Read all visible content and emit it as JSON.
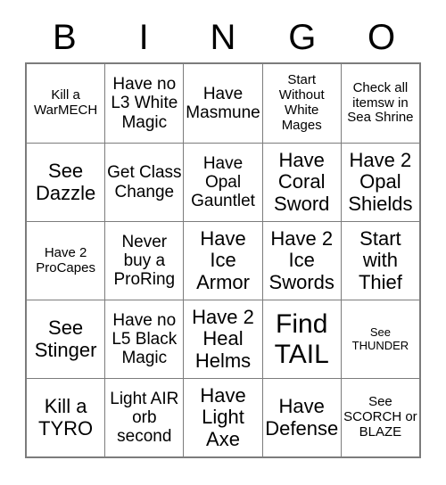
{
  "card": {
    "header": {
      "letters": [
        "B",
        "I",
        "N",
        "G",
        "O"
      ]
    },
    "rows": [
      [
        {
          "text": "Kill a WarMECH",
          "size": "fs-sm"
        },
        {
          "text": "Have no L3 White Magic",
          "size": "fs-md"
        },
        {
          "text": "Have Masmune",
          "size": "fs-md"
        },
        {
          "text": "Start Without White Mages",
          "size": "fs-sm"
        },
        {
          "text": "Check all itemsw in Sea Shrine",
          "size": "fs-sm"
        }
      ],
      [
        {
          "text": "See Dazzle",
          "size": "fs-lg"
        },
        {
          "text": "Get Class Change",
          "size": "fs-md"
        },
        {
          "text": "Have Opal Gauntlet",
          "size": "fs-md"
        },
        {
          "text": "Have Coral Sword",
          "size": "fs-lg"
        },
        {
          "text": "Have 2 Opal Shields",
          "size": "fs-lg"
        }
      ],
      [
        {
          "text": "Have 2 ProCapes",
          "size": "fs-sm"
        },
        {
          "text": "Never buy a ProRing",
          "size": "fs-md"
        },
        {
          "text": "Have Ice Armor",
          "size": "fs-lg"
        },
        {
          "text": "Have 2 Ice Swords",
          "size": "fs-lg"
        },
        {
          "text": "Start with Thief",
          "size": "fs-lg"
        }
      ],
      [
        {
          "text": "See Stinger",
          "size": "fs-lg"
        },
        {
          "text": "Have no L5 Black Magic",
          "size": "fs-md"
        },
        {
          "text": "Have 2 Heal Helms",
          "size": "fs-lg"
        },
        {
          "text": "Find TAIL",
          "size": "fs-xl"
        },
        {
          "text": "See THUNDER",
          "size": "fs-xs"
        }
      ],
      [
        {
          "text": "Kill a TYRO",
          "size": "fs-lg"
        },
        {
          "text": "Light AIR orb second",
          "size": "fs-md"
        },
        {
          "text": "Have Light Axe",
          "size": "fs-lg"
        },
        {
          "text": "Have Defense",
          "size": "fs-lg"
        },
        {
          "text": "See SCORCH or BLAZE",
          "size": "fs-sm"
        }
      ]
    ]
  },
  "colors": {
    "background": "#ffffff",
    "text": "#000000",
    "border": "#7c7c7c"
  }
}
